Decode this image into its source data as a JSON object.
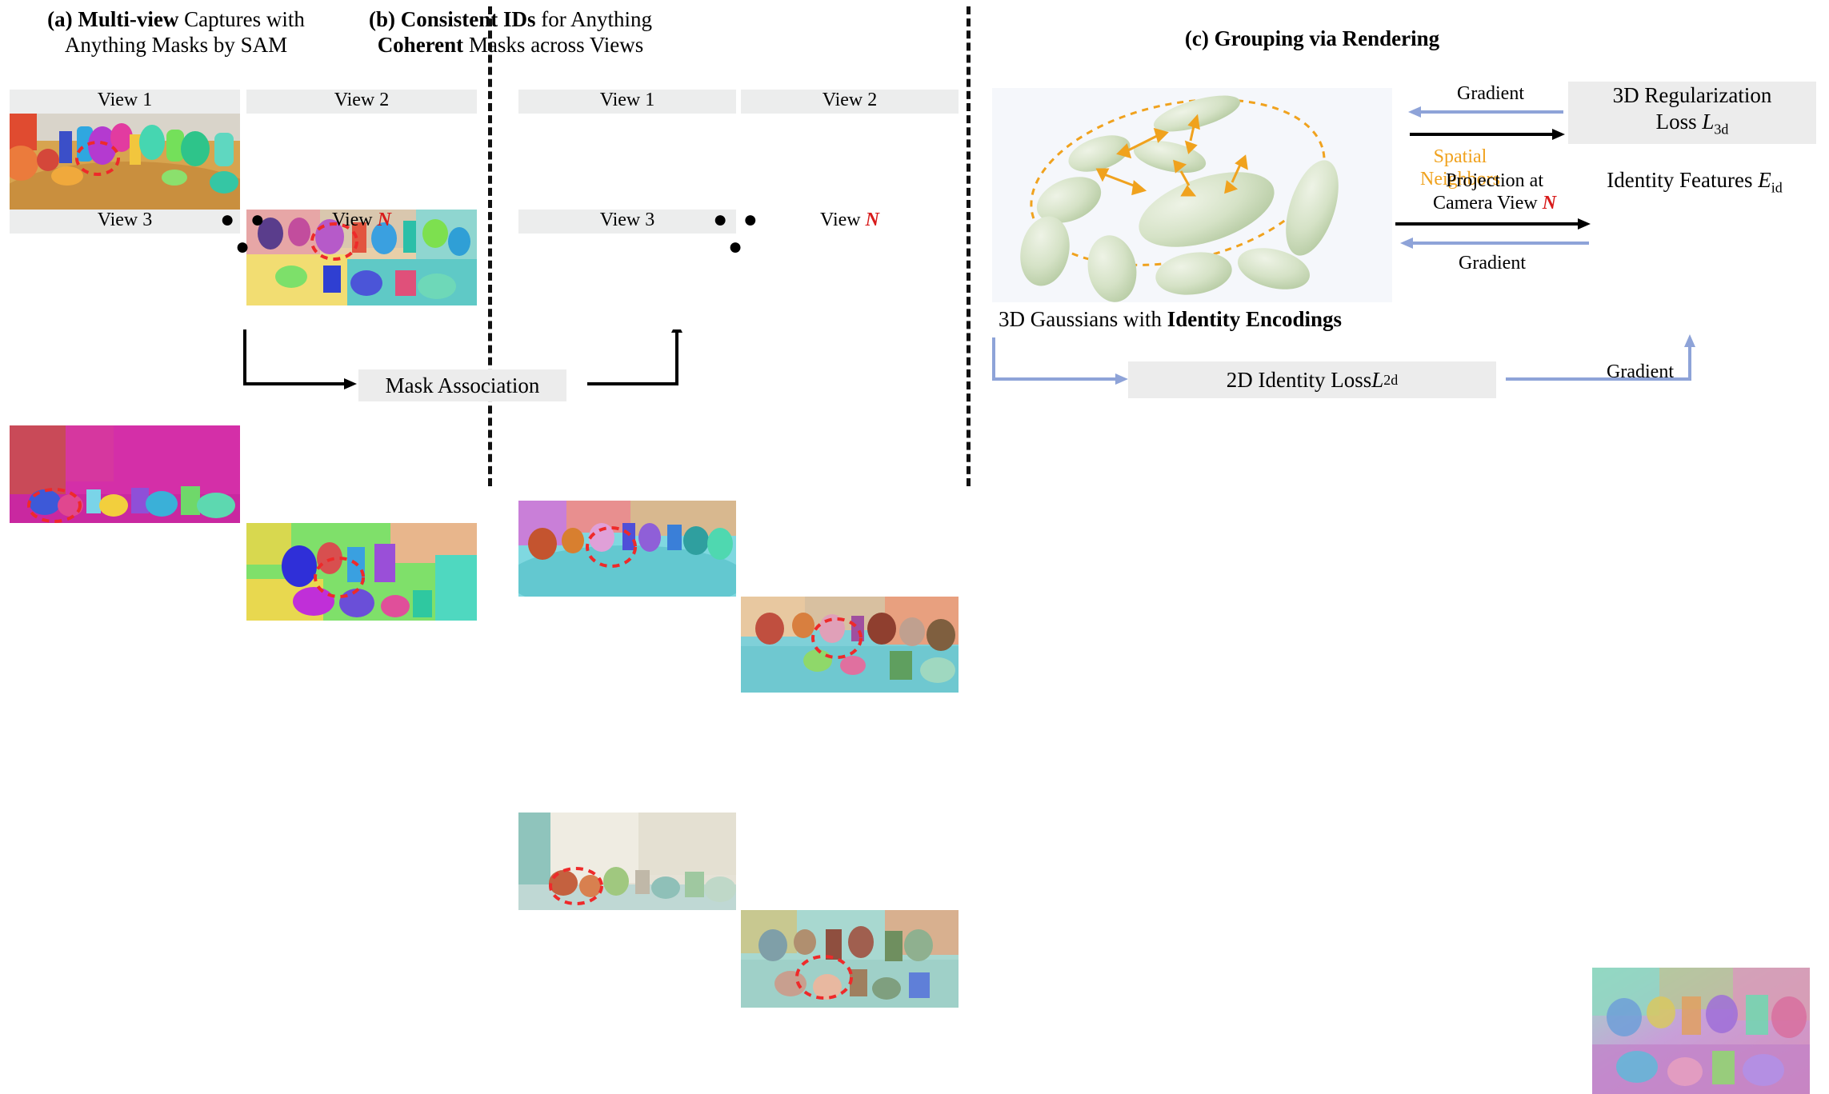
{
  "figure": {
    "domain": "scientific-figure",
    "panels": {
      "a": {
        "title_line1_bold": "(a) Multi-view",
        "title_line1_rest": " Captures with",
        "title_line2": "Anything Masks by SAM",
        "views": [
          {
            "label": "View 1",
            "scene": "tabletop-toys-view1"
          },
          {
            "label": "View 2",
            "scene": "tabletop-toys-view2"
          },
          {
            "label": "View 3",
            "scene": "kitchen-counter-view3"
          },
          {
            "label_prefix": "View ",
            "label_suffix": "N",
            "scene": "room-chairs-viewN"
          }
        ],
        "ellipsis": "● ● ●"
      },
      "b": {
        "title_line1_bold": "(b) Consistent IDs",
        "title_line1_rest": " for Anything",
        "title_line2_bold": "Coherent",
        "title_line2_rest": " Masks across Views",
        "views": [
          {
            "label": "View 1",
            "scene": "tabletop-toys-view1-ids"
          },
          {
            "label": "View 2",
            "scene": "tabletop-toys-view2-ids"
          },
          {
            "label": "View 3",
            "scene": "kitchen-counter-view3-ids"
          },
          {
            "label_prefix": "View ",
            "label_suffix": "N",
            "scene": "room-chairs-viewN-ids"
          }
        ],
        "ellipsis": "● ● ●"
      },
      "c": {
        "title": "(c) Grouping via Rendering",
        "gaussians_caption_plain": "3D Gaussians with ",
        "gaussians_caption_bold": "Identity Encodings",
        "spatial_neighbors_label_line1": "Spatial",
        "spatial_neighbors_label_line2": "Neighbors",
        "identity_features_label": "Identity Features ",
        "identity_features_sub": "E",
        "identity_features_sub_small": "id"
      }
    },
    "boxes": [
      {
        "id": "mask-association",
        "label": "Mask Association"
      },
      {
        "id": "reg-loss",
        "line1": "3D Regularization",
        "line2_plain": "Loss ",
        "line2_math": "L",
        "line2_sub": "3d"
      },
      {
        "id": "identity-loss",
        "line_plain": "2D Identity Loss ",
        "line_math": "L",
        "line_sub": "2d"
      }
    ],
    "arrow_labels": [
      {
        "id": "gradient-top",
        "text": "Gradient"
      },
      {
        "id": "projection",
        "line1": "Projection at",
        "line2_plain": "Camera View ",
        "line2_red": "N"
      },
      {
        "id": "gradient-mid",
        "text": "Gradient"
      },
      {
        "id": "gradient-bottom",
        "text": "Gradient"
      }
    ],
    "colors": {
      "band": "#eceded",
      "box": "#ececec",
      "red_dashed": "#ee2a2a",
      "orange": "#f0a21e",
      "blue_arrow": "#8ea3d8",
      "gaussian_fill": "#cfdcc0",
      "panel_c_bg": "#f5f7fb"
    }
  }
}
